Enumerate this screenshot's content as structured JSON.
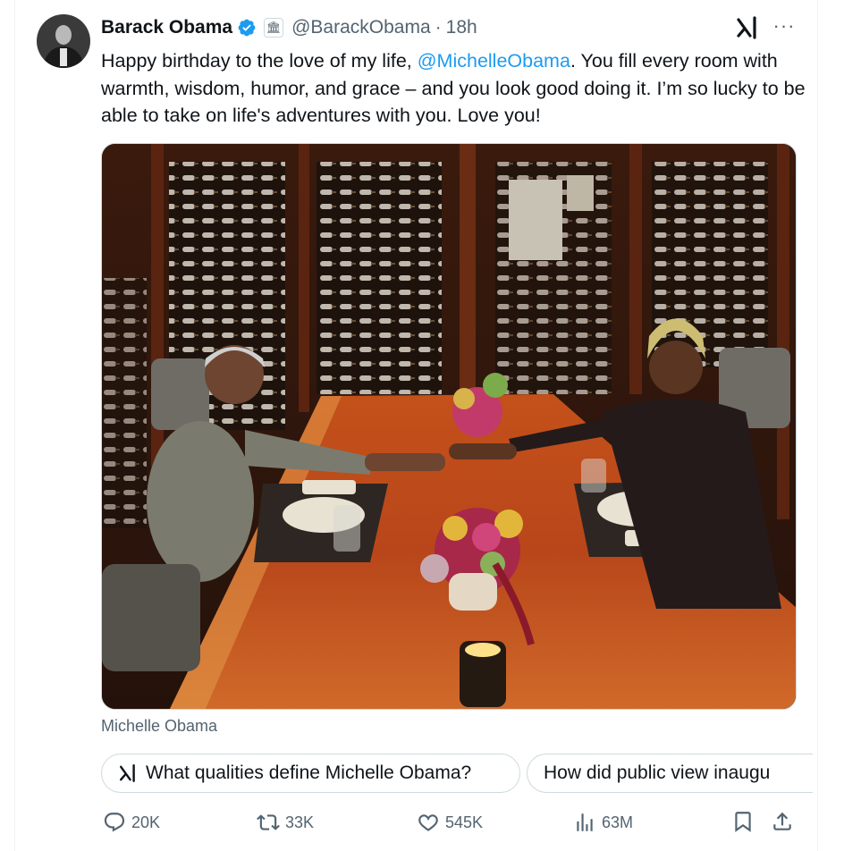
{
  "post": {
    "author_name": "Barack Obama",
    "handle": "@BarackObama",
    "separator": "·",
    "time": "18h",
    "affiliation_badge": "🏛",
    "text_before": "Happy birthday to the love of my life, ",
    "mention": "@MichelleObama",
    "text_after": ". You fill every room with warmth, wisdom, humor, and grace – and you look good doing it. I’m so lucky to be able to take on life's adventures with you. Love you!",
    "more_label": "···",
    "media_tag": "Michelle Obama"
  },
  "grok_prompts": [
    "What qualities define Michelle Obama?",
    "How did public view inaugu"
  ],
  "actions": {
    "replies": "20K",
    "reposts": "33K",
    "likes": "545K",
    "views": "63M"
  },
  "colors": {
    "accent": "#1d9bf0",
    "text_secondary": "#536471",
    "border": "#cfd9de"
  },
  "icons": [
    "verified-icon",
    "affiliation-badge-icon",
    "grok-icon",
    "more-icon",
    "reply-icon",
    "repost-icon",
    "like-icon",
    "views-icon",
    "bookmark-icon",
    "share-icon"
  ]
}
